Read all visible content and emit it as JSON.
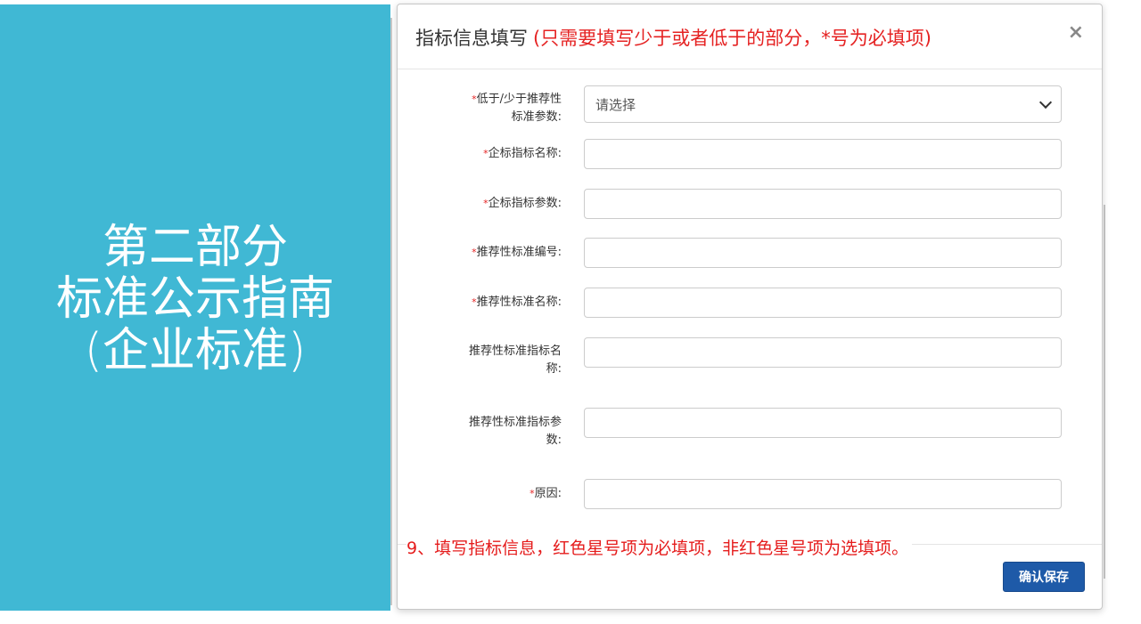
{
  "left_panel": {
    "lines": [
      "第二部分",
      "标准公示指南",
      "(企业标准)"
    ],
    "background_color": "#40b8d4"
  },
  "modal": {
    "title": "指标信息填写",
    "title_note": "(只需要填写少于或者低于的部分，*号为必填项)",
    "close_label": "×",
    "fields": [
      {
        "label": "低于/少于推荐性标准参数:",
        "required": true,
        "type": "select",
        "value": "请选择"
      },
      {
        "label": "企标指标名称:",
        "required": true,
        "type": "text",
        "value": ""
      },
      {
        "label": "企标指标参数:",
        "required": true,
        "type": "text",
        "value": ""
      },
      {
        "label": "推荐性标准编号:",
        "required": true,
        "type": "text",
        "value": ""
      },
      {
        "label": "推荐性标准名称:",
        "required": true,
        "type": "text",
        "value": ""
      },
      {
        "label": "推荐性标准指标名称:",
        "required": false,
        "type": "text",
        "value": ""
      },
      {
        "label": "推荐性标准指标参数:",
        "required": false,
        "type": "text",
        "value": ""
      },
      {
        "label": "原因:",
        "required": true,
        "type": "text",
        "value": ""
      }
    ],
    "required_marker": "*",
    "instruction": "9、填写指标信息，红色星号项为必填项，非红色星号项为选填项。",
    "confirm_label": "确认保存",
    "colors": {
      "required": "#e52222",
      "primary_button": "#1e5aa8"
    }
  }
}
